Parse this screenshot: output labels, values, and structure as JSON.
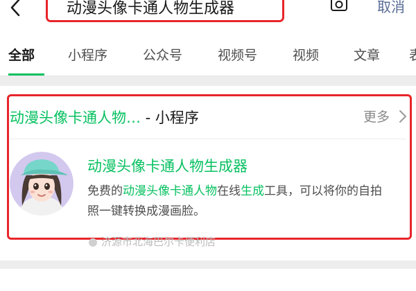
{
  "search": {
    "query": "动漫头像卡通人物生成器",
    "cancel_label": "取消"
  },
  "tabs": [
    {
      "label": "全部",
      "active": true
    },
    {
      "label": "小程序"
    },
    {
      "label": "公众号"
    },
    {
      "label": "视频号"
    },
    {
      "label": "视频"
    },
    {
      "label": "文章"
    },
    {
      "label": "表"
    }
  ],
  "result_section": {
    "title_highlight": "动漫头像卡通人物…",
    "title_suffix": " - 小程序",
    "more_label": "更多"
  },
  "result_item": {
    "name": "动漫头像卡通人物生成器",
    "desc_parts": [
      {
        "text": "免费的",
        "green": false
      },
      {
        "text": "动漫头像卡通人物",
        "green": true
      },
      {
        "text": "在线",
        "green": false
      },
      {
        "text": "生成",
        "green": true
      },
      {
        "text": "工具，可以将你的自拍照一键转换成漫画脸。",
        "green": false
      }
    ],
    "location": "济源市北海巴尔卡便利店"
  },
  "colors": {
    "accent_green": "#07c160",
    "highlight_red": "#e8252a",
    "link_blue": "#576b95"
  }
}
